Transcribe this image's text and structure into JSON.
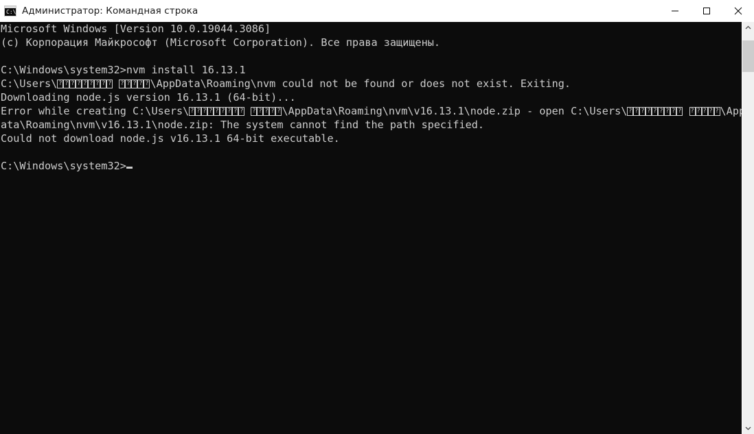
{
  "window": {
    "title": "Администратор: Командная строка",
    "icon": "cmd-console-icon",
    "background_color": "#0c0c0c",
    "titlebar_color": "#ffffff",
    "text_color": "#cccccc"
  },
  "controls": {
    "minimize": "minimize-button",
    "maximize": "maximize-button",
    "close": "close-button"
  },
  "console": {
    "lines": [
      {
        "id": "line-1",
        "text": "Microsoft Windows [Version 10.0.19044.3086]"
      },
      {
        "id": "line-2",
        "text": "(c) Корпорация Майкрософт (Microsoft Corporation). Все права защищены."
      },
      {
        "id": "line-3",
        "text": ""
      },
      {
        "id": "line-4",
        "text": "C:\\Windows\\system32>nvm install 16.13.1"
      },
      {
        "id": "line-5",
        "text": "C:\\Users\\~~~~~~~~~ ~~~~~\\AppData\\Roaming\\nvm could not be found or does not exist. Exiting."
      },
      {
        "id": "line-6",
        "text": "Downloading node.js version 16.13.1 (64-bit)..."
      },
      {
        "id": "line-7",
        "text": "Error while creating C:\\Users\\~~~~~~~~~ ~~~~~\\AppData\\Roaming\\nvm\\v16.13.1\\node.zip - open C:\\Users\\~~~~~~~~~ ~~~~~\\AppD"
      },
      {
        "id": "line-8",
        "text": "ata\\Roaming\\nvm\\v16.13.1\\node.zip: The system cannot find the path specified."
      },
      {
        "id": "line-9",
        "text": "Could not download node.js v16.13.1 64-bit executable."
      },
      {
        "id": "line-10",
        "text": ""
      },
      {
        "id": "line-11",
        "text": "C:\\Windows\\system32>",
        "cursor": true
      }
    ],
    "unrenderable_placeholder": "?",
    "note_hidden_username_glyph_count": [
      9,
      5
    ]
  },
  "scrollbar": {
    "up_arrow": "scroll-up-arrow-icon",
    "down_arrow": "scroll-down-arrow-icon",
    "thumb": "scrollbar-thumb"
  }
}
